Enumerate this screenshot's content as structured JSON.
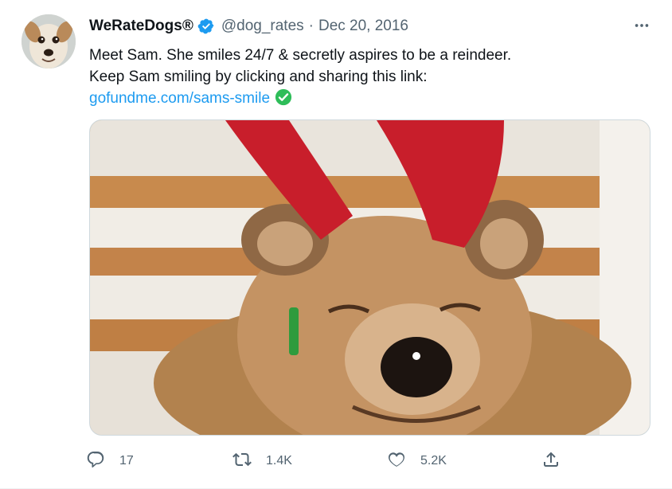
{
  "tweet": {
    "author_name": "WeRateDogs®",
    "handle": "@dog_rates",
    "separator": "·",
    "date": "Dec 20, 2016",
    "text_line_1": "Meet Sam. She smiles 24/7 & secretly aspires to be a reindeer.",
    "text_line_2": "Keep Sam smiling by clicking and sharing this link:",
    "link_text": "gofundme.com/sams-smile"
  },
  "icons": {
    "verified": "verified-badge-icon",
    "link_check": "check-circle-icon",
    "more": "more-horizontal-icon",
    "reply": "reply-icon",
    "retweet": "retweet-icon",
    "like": "heart-icon",
    "share": "share-icon"
  },
  "actions": {
    "replies": "17",
    "retweets": "1.4K",
    "likes": "5.2K"
  },
  "colors": {
    "link": "#1d9bf0",
    "secondary_text": "#536471",
    "verified": "#1d9bf0",
    "check_green": "#2ebd59"
  }
}
